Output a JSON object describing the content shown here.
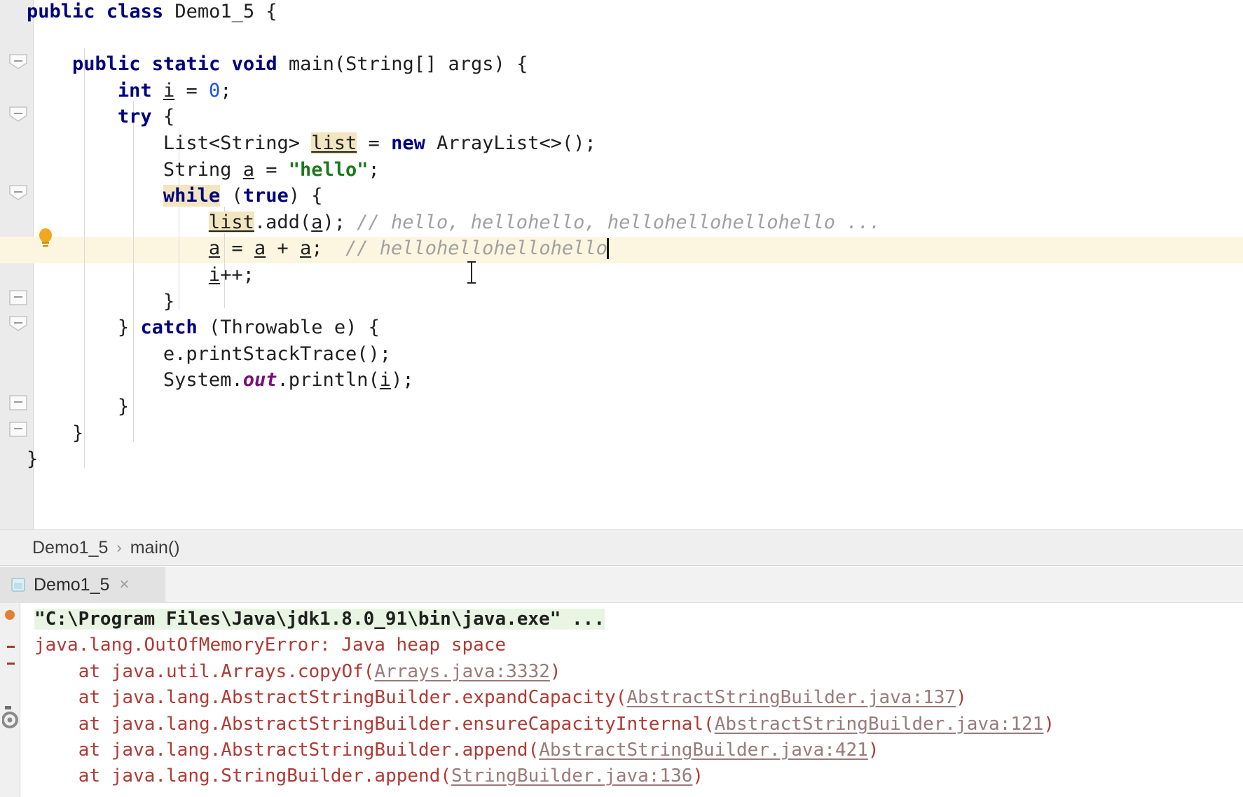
{
  "editor": {
    "language": "java",
    "class_name": "Demo1_5",
    "lines": [
      {
        "id": "l1",
        "indent": 0,
        "text": "public class Demo1_5 {"
      },
      {
        "id": "l2",
        "indent": 0,
        "text": ""
      },
      {
        "id": "l3",
        "indent": 1,
        "text": "public static void main(String[] args) {"
      },
      {
        "id": "l4",
        "indent": 2,
        "text": "int i = 0;"
      },
      {
        "id": "l5",
        "indent": 2,
        "text": "try {"
      },
      {
        "id": "l6",
        "indent": 3,
        "text": "List<String> list = new ArrayList<>();"
      },
      {
        "id": "l7",
        "indent": 3,
        "text": "String a = \"hello\";"
      },
      {
        "id": "l8",
        "indent": 3,
        "text": "while (true) {"
      },
      {
        "id": "l9",
        "indent": 4,
        "text": "list.add(a); // hello, hellohello, hellohellohellohello ..."
      },
      {
        "id": "l10",
        "indent": 4,
        "text": "a = a + a;  // hellohellohellohello"
      },
      {
        "id": "l11",
        "indent": 4,
        "text": "i++;"
      },
      {
        "id": "l12",
        "indent": 3,
        "text": "}"
      },
      {
        "id": "l13",
        "indent": 2,
        "text": "} catch (Throwable e) {"
      },
      {
        "id": "l14",
        "indent": 3,
        "text": "e.printStackTrace();"
      },
      {
        "id": "l15",
        "indent": 3,
        "text": "System.out.println(i);"
      },
      {
        "id": "l16",
        "indent": 2,
        "text": "}"
      },
      {
        "id": "l17",
        "indent": 1,
        "text": "}"
      },
      {
        "id": "l18",
        "indent": 0,
        "text": "}"
      }
    ],
    "highlighted_identifiers": [
      "list",
      "while"
    ],
    "current_line_id": "l10",
    "caret_line": "a = a + a;  // hellohellohellohello",
    "intention_hint": "lightbulb-intention-action",
    "fold_markers": [
      "l3",
      "l5",
      "l8",
      "l13-end",
      "l13",
      "l17"
    ],
    "colors": {
      "keyword": "#00007f",
      "string": "#1a7a1a",
      "number": "#1750eb",
      "comment": "#a0a0a0",
      "static_field": "#7a0e7a",
      "identifier_highlight": "#f2e6c0",
      "current_line": "#fcf6e1",
      "gutter": "#ebebeb"
    }
  },
  "breadcrumb": {
    "items": [
      "Demo1_5",
      "main()"
    ],
    "separator": "›"
  },
  "run_window": {
    "tab": {
      "label": "Demo1_5",
      "icon": "run-configuration-icon",
      "close_label": "×"
    },
    "sidebar_icons": [
      "run-status-dot",
      "settings-gear-icon"
    ],
    "console_lines": [
      {
        "id": "c1",
        "kind": "command",
        "text": "\"C:\\Program Files\\Java\\jdk1.8.0_91\\bin\\java.exe\" ...",
        "indent": 0
      },
      {
        "id": "c2",
        "kind": "exception",
        "text": "java.lang.OutOfMemoryError: Java heap space",
        "indent": 0
      },
      {
        "id": "c3",
        "kind": "stack",
        "prefix": "at java.util.Arrays.copyOf(",
        "link": "Arrays.java:3332",
        "suffix": ")",
        "indent": 1
      },
      {
        "id": "c4",
        "kind": "stack",
        "prefix": "at java.lang.AbstractStringBuilder.expandCapacity(",
        "link": "AbstractStringBuilder.java:137",
        "suffix": ")",
        "indent": 1
      },
      {
        "id": "c5",
        "kind": "stack",
        "prefix": "at java.lang.AbstractStringBuilder.ensureCapacityInternal(",
        "link": "AbstractStringBuilder.java:121",
        "suffix": ")",
        "indent": 1
      },
      {
        "id": "c6",
        "kind": "stack",
        "prefix": "at java.lang.AbstractStringBuilder.append(",
        "link": "AbstractStringBuilder.java:421",
        "suffix": ")",
        "indent": 1
      },
      {
        "id": "c7",
        "kind": "stack",
        "prefix": "at java.lang.StringBuilder.append(",
        "link": "StringBuilder.java:136",
        "suffix": ")",
        "indent": 1
      }
    ],
    "colors": {
      "error_text": "#b03a34",
      "command_highlight": "#e9f5e3",
      "link": "#9a7a7a",
      "tab_active_bg": "#e2e2e2"
    }
  }
}
